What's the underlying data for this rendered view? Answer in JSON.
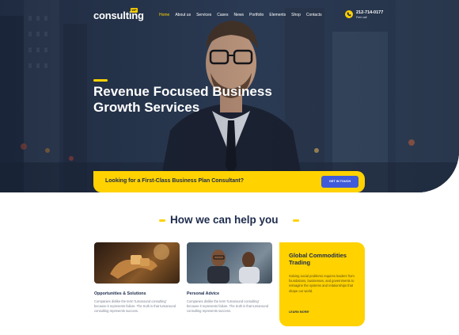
{
  "header": {
    "logo_text": "consulting",
    "logo_badge": "WP",
    "nav": [
      {
        "label": "Home",
        "active": true
      },
      {
        "label": "About us",
        "active": false
      },
      {
        "label": "Services",
        "active": false
      },
      {
        "label": "Cases",
        "active": false
      },
      {
        "label": "News",
        "active": false
      },
      {
        "label": "Portfolio",
        "active": false
      },
      {
        "label": "Elements",
        "active": false
      },
      {
        "label": "Shop",
        "active": false
      },
      {
        "label": "Contacts",
        "active": false
      }
    ],
    "phone": "212-714-0177",
    "phone_sub": "Free call"
  },
  "hero": {
    "title_line1": "Revenue Focused Business",
    "title_line2": "Growth Services"
  },
  "cta": {
    "text": "Looking for a First-Class Business Plan Consultant?",
    "button": "GET IN TOUCH"
  },
  "section": {
    "title": "How we can help you"
  },
  "cards": [
    {
      "title": "Opportunities & Solutions",
      "desc": "Companies dislike the term 'turnaround consulting' because it represents failure. The truth is that turnaround consulting represents success."
    },
    {
      "title": "Personal Advice",
      "desc": "Companies dislike the term 'turnaround consulting' because it represents failure. The truth is that turnaround consulting represents success."
    }
  ],
  "feature": {
    "title": "Global Commodities Trading",
    "desc": "Solving social problems requires leaders from foundations, businesses, and governments to reimagine the systems and relationships that shape our world.",
    "link": "LEARN MORE"
  },
  "colors": {
    "accent": "#ffd200",
    "navy": "#1d2b4c",
    "button": "#3f5bd9"
  }
}
